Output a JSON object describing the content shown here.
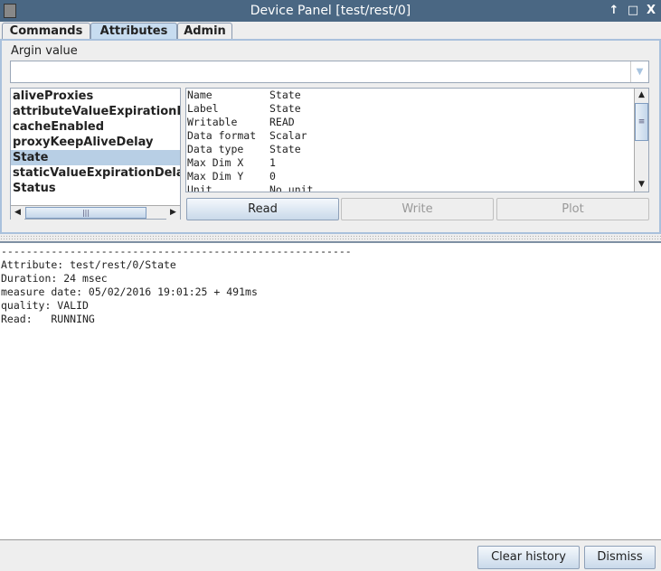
{
  "window": {
    "title": "Device Panel [test/rest/0]",
    "controls": [
      "↑",
      "□",
      "X"
    ]
  },
  "tabs": [
    {
      "label": "Commands"
    },
    {
      "label": "Attributes",
      "selected": true
    },
    {
      "label": "Admin"
    }
  ],
  "argin": {
    "label": "Argin value",
    "value": ""
  },
  "attributes": [
    {
      "label": "aliveProxies"
    },
    {
      "label": "attributeValueExpirationD"
    },
    {
      "label": "cacheEnabled"
    },
    {
      "label": "proxyKeepAliveDelay"
    },
    {
      "label": "State",
      "selected": true
    },
    {
      "label": "staticValueExpirationDelay"
    },
    {
      "label": "Status"
    }
  ],
  "details": [
    {
      "key": "Name",
      "value": "State"
    },
    {
      "key": "Label",
      "value": "State"
    },
    {
      "key": "Writable",
      "value": "READ"
    },
    {
      "key": "Data format",
      "value": "Scalar"
    },
    {
      "key": "Data type",
      "value": "State"
    },
    {
      "key": "Max Dim X",
      "value": "1"
    },
    {
      "key": "Max Dim Y",
      "value": "0"
    },
    {
      "key": "Unit",
      "value": "No unit"
    }
  ],
  "actions": {
    "read": "Read",
    "write": "Write",
    "plot": "Plot"
  },
  "output": [
    "--------------------------------------------------------",
    "Attribute: test/rest/0/State",
    "Duration: 24 msec",
    "measure date: 05/02/2016 19:01:25 + 491ms",
    "quality: VALID",
    "Read:   RUNNING"
  ],
  "footer": {
    "clear": "Clear history",
    "dismiss": "Dismiss"
  }
}
